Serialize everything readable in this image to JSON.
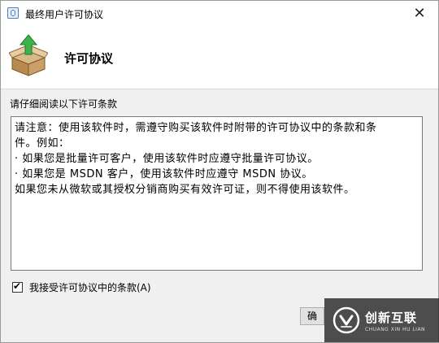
{
  "window": {
    "title": "最终用户许可协议",
    "close_glyph": "✕"
  },
  "header": {
    "title": "许可协议",
    "icon": "package-install-icon"
  },
  "instruction": "请仔细阅读以下许可条款",
  "license_lines": [
    "请注意：使用该软件时，需遵守购买该软件时附带的许可协议中的条款和条",
    "件。例如：",
    "· 如果您是批量许可客户，使用该软件时应遵守批量许可协议。",
    "· 如果您是 MSDN 客户，使用该软件时应遵守 MSDN 协议。",
    "如果您未从微软或其授权分销商购买有效许可证，则不得使用该软件。"
  ],
  "accept": {
    "label": "我接受许可协议中的条款(A)",
    "checked": true,
    "check_glyph": "✔"
  },
  "ok_button_label": "确",
  "watermark": {
    "brand": "创新互联",
    "sub": "CHUANG XIN HU LIAN"
  },
  "colors": {
    "dialog_bg": "#f0f0f0",
    "header_bg": "#ffffff",
    "watermark_bg": "#2a2a2a"
  }
}
